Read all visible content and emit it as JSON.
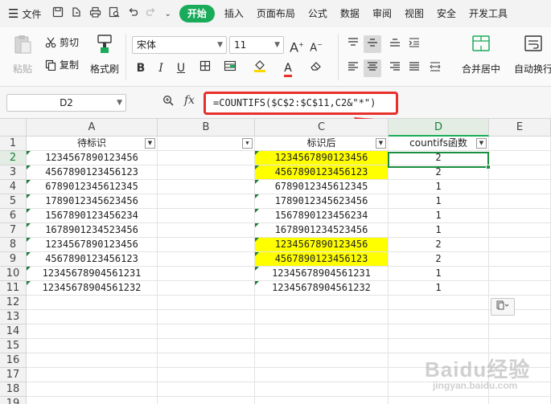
{
  "menu": {
    "file_label": "文件",
    "tabs": [
      "开始",
      "插入",
      "页面布局",
      "公式",
      "数据",
      "审阅",
      "视图",
      "安全",
      "开发工具"
    ],
    "active_tab": "开始"
  },
  "ribbon": {
    "paste_label": "粘贴",
    "cut_label": "剪切",
    "copy_label": "复制",
    "format_painter_label": "格式刷",
    "font_name": "宋体",
    "font_size": "11",
    "merge_center_label": "合并居中",
    "auto_wrap_label": "自动换行",
    "font_color": "#e8302b",
    "fill_color": "#ffd700"
  },
  "formula_bar": {
    "cell_ref": "D2",
    "fx_label": "fx",
    "formula": "=COUNTIFS($C$2:$C$11,C2&\"*\")"
  },
  "sheet": {
    "columns": [
      "A",
      "B",
      "C",
      "D",
      "E"
    ],
    "selected_column": "D",
    "selected_row": 2,
    "rows": [
      "1",
      "2",
      "3",
      "4",
      "5",
      "6",
      "7",
      "8",
      "9",
      "10",
      "11",
      "12",
      "13",
      "14",
      "15",
      "16",
      "17",
      "18",
      "19"
    ],
    "header_a": "待标识",
    "header_c": "标识后",
    "header_d": "countifs函数",
    "col_a": [
      "1234567890123456",
      "4567890123456123",
      "6789012345612345",
      "1789012345623456",
      "1567890123456234",
      "1678901234523456",
      "1234567890123456",
      "4567890123456123",
      "12345678904561231",
      "12345678904561232"
    ],
    "col_c": [
      "1234567890123456",
      "4567890123456123",
      "6789012345612345",
      "1789012345623456",
      "1567890123456234",
      "1678901234523456",
      "1234567890123456",
      "4567890123456123",
      "12345678904561231",
      "12345678904561232"
    ],
    "col_d": [
      "2",
      "2",
      "1",
      "1",
      "1",
      "1",
      "2",
      "2",
      "1",
      "1"
    ],
    "highlight_color": "#ffff00"
  },
  "watermark": {
    "brand": "Baidu经验",
    "sub": "jingyan.baidu.com"
  }
}
